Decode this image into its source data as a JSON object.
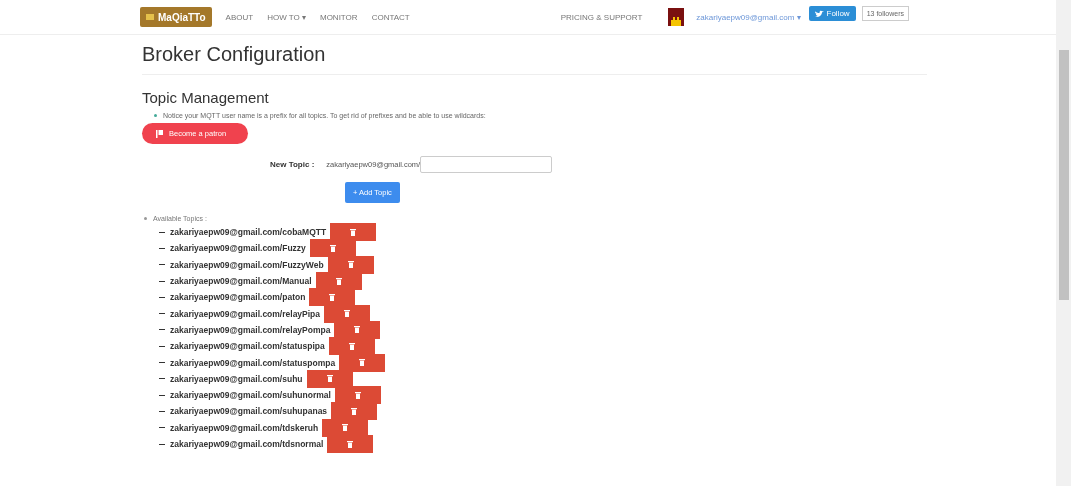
{
  "nav": {
    "logo": "MaQiaTTo",
    "links": [
      {
        "label": "ABOUT"
      },
      {
        "label": "HOW TO ▾"
      },
      {
        "label": "MONITOR"
      },
      {
        "label": "CONTACT"
      }
    ],
    "pricing": "PRICING & SUPPORT",
    "user_email": "zakariyaepw09@gmail.com ▾",
    "follow_button": "Follow",
    "followers": "13 followers"
  },
  "title": "Broker Configuration",
  "section_title": "Topic Management",
  "notice": "Notice your MQTT user name is a prefix for all topics. To get rid of prefixes and be able to use wildcards:",
  "patron_button": "Become a patron",
  "new_topic": {
    "label": "New Topic :",
    "prefix": "zakariyaepw09@gmail.com/"
  },
  "add_button": "+ Add Topic",
  "available_label": "Available Topics :",
  "topics": [
    {
      "name": "zakariyaepw09@gmail.com/cobaMQTT"
    },
    {
      "name": "zakariyaepw09@gmail.com/Fuzzy"
    },
    {
      "name": "zakariyaepw09@gmail.com/FuzzyWeb"
    },
    {
      "name": "zakariyaepw09@gmail.com/Manual"
    },
    {
      "name": "zakariyaepw09@gmail.com/paton"
    },
    {
      "name": "zakariyaepw09@gmail.com/relayPipa"
    },
    {
      "name": "zakariyaepw09@gmail.com/relayPompa"
    },
    {
      "name": "zakariyaepw09@gmail.com/statuspipa"
    },
    {
      "name": "zakariyaepw09@gmail.com/statuspompa"
    },
    {
      "name": "zakariyaepw09@gmail.com/suhu"
    },
    {
      "name": "zakariyaepw09@gmail.com/suhunormal"
    },
    {
      "name": "zakariyaepw09@gmail.com/suhupanas"
    },
    {
      "name": "zakariyaepw09@gmail.com/tdskeruh"
    },
    {
      "name": "zakariyaepw09@gmail.com/tdsnormal"
    }
  ]
}
